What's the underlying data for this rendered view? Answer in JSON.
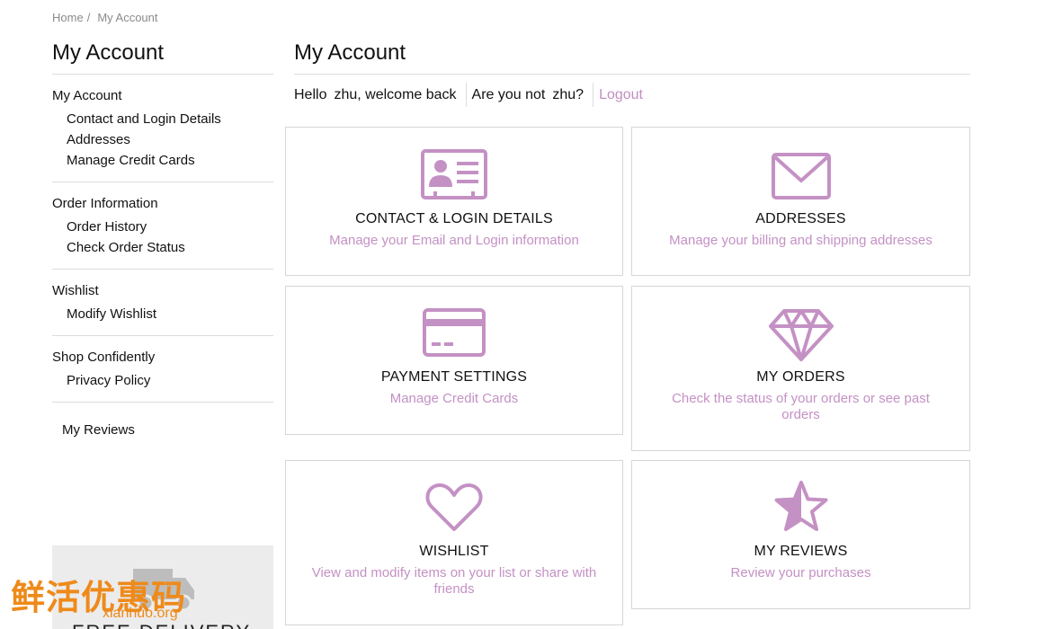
{
  "breadcrumb": {
    "home": "Home",
    "separator": "/",
    "current": "My Account"
  },
  "sidebar": {
    "title": "My Account",
    "groups": [
      {
        "heading": "My Account",
        "items": [
          "Contact and Login Details",
          "Addresses",
          "Manage Credit Cards"
        ]
      },
      {
        "heading": "Order Information",
        "items": [
          "Order History",
          "Check Order Status"
        ]
      },
      {
        "heading": "Wishlist",
        "items": [
          "Modify Wishlist"
        ]
      },
      {
        "heading": "Shop Confidently",
        "items": [
          "Privacy Policy"
        ]
      },
      {
        "heading": "My Reviews",
        "items": []
      }
    ],
    "promo": {
      "text": "FREE DELIVERY",
      "icon": "truck-icon"
    }
  },
  "main": {
    "title": "My Account",
    "greeting": {
      "hello": "Hello",
      "name": "zhu, welcome back",
      "not_you": "Are you not",
      "not_name": "zhu?",
      "logout": "Logout"
    },
    "cards": [
      {
        "title": "CONTACT & LOGIN DETAILS",
        "desc": "Manage your Email and Login information",
        "icon": "id-card-icon"
      },
      {
        "title": "ADDRESSES",
        "desc": "Manage your billing and shipping addresses",
        "icon": "envelope-icon"
      },
      {
        "title": "PAYMENT SETTINGS",
        "desc": "Manage Credit Cards",
        "icon": "credit-card-icon"
      },
      {
        "title": "MY ORDERS",
        "desc": "Check the status of your orders or see past orders",
        "icon": "diamond-icon"
      },
      {
        "title": "WISHLIST",
        "desc": "View and modify items on your list or share with friends",
        "icon": "heart-icon"
      },
      {
        "title": "MY REVIEWS",
        "desc": "Review your purchases",
        "icon": "star-icon"
      }
    ]
  },
  "watermark": {
    "cn": "鲜活优惠码",
    "en": "xianhuo.org"
  },
  "colors": {
    "accent": "#c491c4",
    "border": "#d6d6d6",
    "text": "#111111"
  }
}
